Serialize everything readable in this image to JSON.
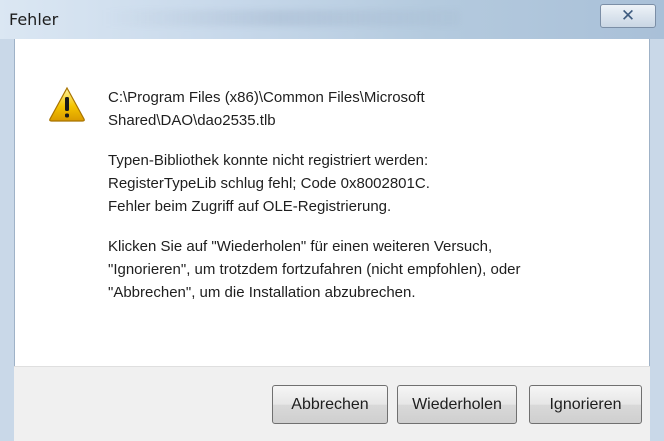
{
  "window": {
    "title": "Fehler",
    "close_icon": "close-icon"
  },
  "message": {
    "icon": "warning-icon",
    "path_line1": "C:\\Program Files (x86)\\Common Files\\Microsoft",
    "path_line2": "Shared\\DAO\\dao2535.tlb",
    "error_line1": "Typen-Bibliothek konnte nicht registriert werden:",
    "error_line2": "RegisterTypeLib schlug fehl; Code 0x8002801C.",
    "error_line3": "Fehler beim Zugriff auf OLE-Registrierung.",
    "hint_line1": "Klicken Sie auf \"Wiederholen\" für einen weiteren Versuch,",
    "hint_line2": "\"Ignorieren\", um trotzdem fortzufahren (nicht empfohlen), oder",
    "hint_line3": "\"Abbrechen\", um die Installation abzubrechen."
  },
  "buttons": {
    "abbrechen": "Abbrechen",
    "wiederholen": "Wiederholen",
    "ignorieren": "Ignorieren"
  },
  "colors": {
    "titlebar_accent": "#b4cade",
    "warning_yellow": "#f5c400",
    "footer_bg": "#f0f0f0"
  }
}
